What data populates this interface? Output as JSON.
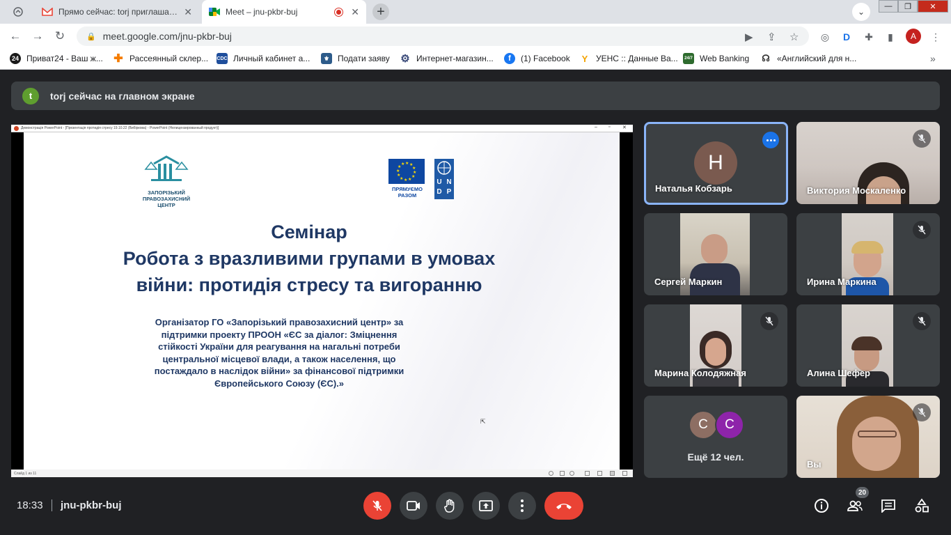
{
  "browser": {
    "tabs": [
      {
        "title": "Прямо сейчас: torj приглашает с"
      },
      {
        "title": "Meet – jnu-pkbr-buj"
      }
    ],
    "url": "meet.google.com/jnu-pkbr-buj",
    "profile_initial": "A",
    "bookmarks": [
      {
        "label": "Приват24 - Ваш ж..."
      },
      {
        "label": "Рассеянный склер..."
      },
      {
        "label": "Личный кабинет а..."
      },
      {
        "label": "Подати заяву"
      },
      {
        "label": "Интернет-магазин..."
      },
      {
        "label": "(1) Facebook"
      },
      {
        "label": "УЕНС :: Данные Ва..."
      },
      {
        "label": "Web Banking"
      },
      {
        "label": "«Английский для н..."
      }
    ]
  },
  "meet": {
    "banner": {
      "avatar_initial": "t",
      "text": "torj сейчас на главном экране"
    },
    "presentation": {
      "window_title": "Демонстрація PowerPoint - [Презентація протидія стресу 19.10.22 (Вибіркова) - PowerPoint (Нелицензированный продукт)]",
      "status": "Слайд 1 из 11",
      "org_logo_text": "ЗАПОРІЗЬКИЙ ПРАВОЗАХИСНИЙ ЦЕНТР",
      "eu_caption": "ПРЯМУЄМО РАЗОМ",
      "undp_letters": [
        "U",
        "N",
        "D",
        "P"
      ],
      "title_lines": [
        "Семінар",
        "Робота з вразливими групами в умовах",
        "війни: протидія стресу та вигоранню"
      ],
      "body_lines": [
        "Організатор  ГО «Запорізький правозахисний центр» за",
        "підтримки  проекту ПРООН «ЄС за діалог: Зміцнення",
        "стійкості України для реагування на нагальні потреби",
        "центральної місцевої влади, а також населення, що",
        "постаждало в наслідок війни» за фінансової підтримки",
        "Європейського Союзу (ЄС).»"
      ]
    },
    "participants": [
      {
        "name": "Наталья Кобзарь",
        "initial": "Н"
      },
      {
        "name": "Виктория Москаленко"
      },
      {
        "name": "Сергей Маркин"
      },
      {
        "name": "Ирина Маркина"
      },
      {
        "name": "Марина Колодяжная"
      },
      {
        "name": "Алина Шефер"
      },
      {
        "name": "Вы"
      }
    ],
    "others": {
      "initials": [
        "С",
        "С"
      ],
      "label": "Ещё 12 чел."
    },
    "bottom": {
      "time": "18:33",
      "meeting_code": "jnu-pkbr-buj",
      "people_count": "20"
    },
    "colors": {
      "accent_blue": "#1a73e8",
      "danger_red": "#ea4335",
      "tile_bg": "#3c4043",
      "slide_text": "#1f3864"
    }
  }
}
